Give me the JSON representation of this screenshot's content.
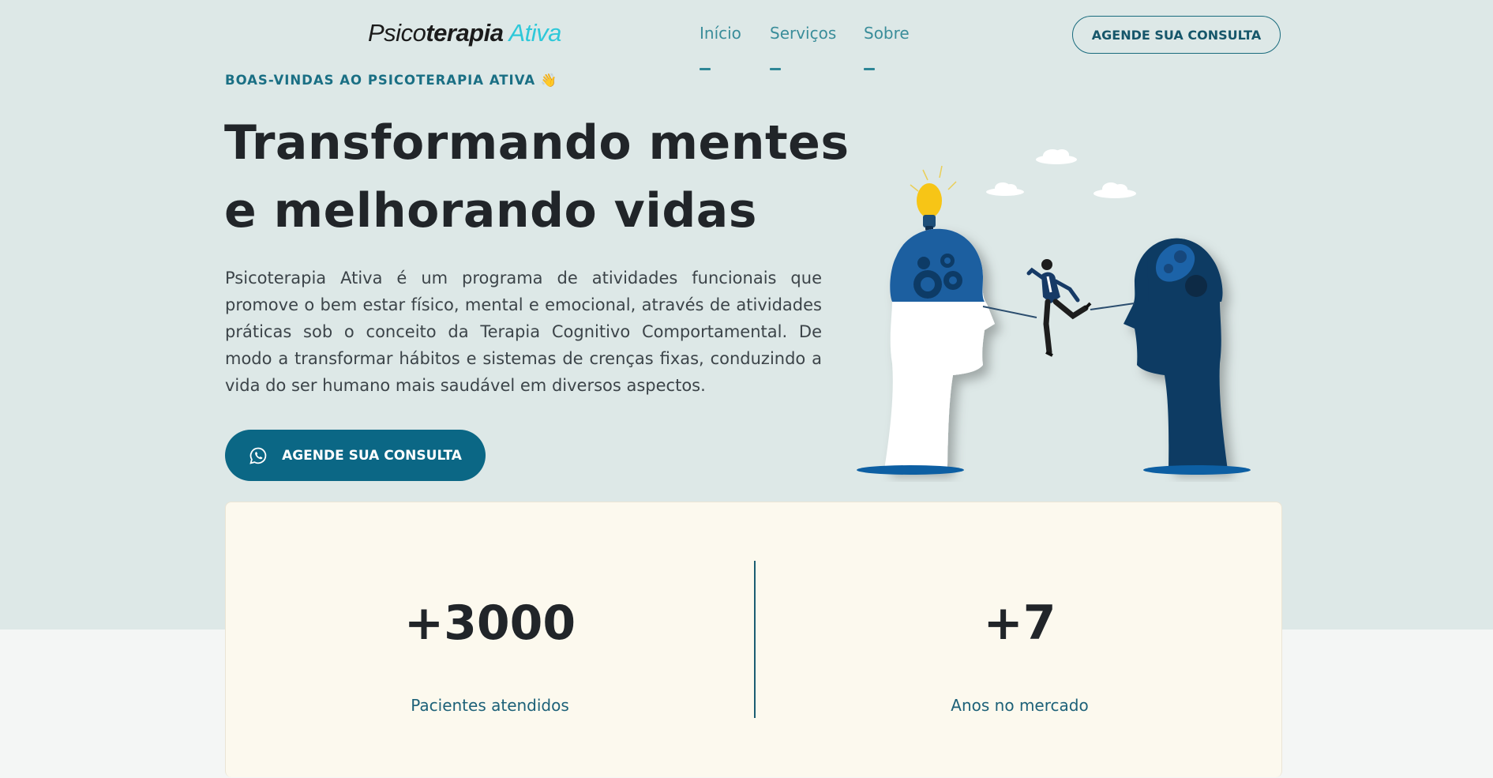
{
  "header": {
    "logo": {
      "part1": "Psico",
      "part2": "terapia",
      "part3": "Ativa"
    },
    "nav": [
      {
        "label": "Início"
      },
      {
        "label": "Serviços"
      },
      {
        "label": "Sobre"
      }
    ],
    "cta_label": "AGENDE SUA CONSULTA"
  },
  "hero": {
    "eyebrow": "BOAS-VINDAS AO PSICOTERAPIA ATIVA 👋",
    "headline": "Transformando mentes e melhorando vidas",
    "description": "Psicoterapia Ativa é um programa de atividades funcionais que promove o bem estar físico, mental e emocional, através de atividades práticas sob o conceito da Terapia Cognitivo Comportamental. De modo a transformar hábitos e sistemas de crenças fixas, conduzindo a vida do ser humano mais saudável em diversos aspectos.",
    "cta_label": "AGENDE SUA CONSULTA",
    "cta_icon": "whatsapp-icon"
  },
  "stats": [
    {
      "value": "+3000",
      "label": "Pacientes atendidos"
    },
    {
      "value": "+7",
      "label": "Anos no mercado"
    }
  ],
  "colors": {
    "hero_bg": "#dde8e7",
    "primary": "#0b6785",
    "nav_text": "#3a8d9a",
    "logo_accent": "#2ec8d9",
    "card_bg": "#fcf9ee",
    "heading": "#212529"
  }
}
